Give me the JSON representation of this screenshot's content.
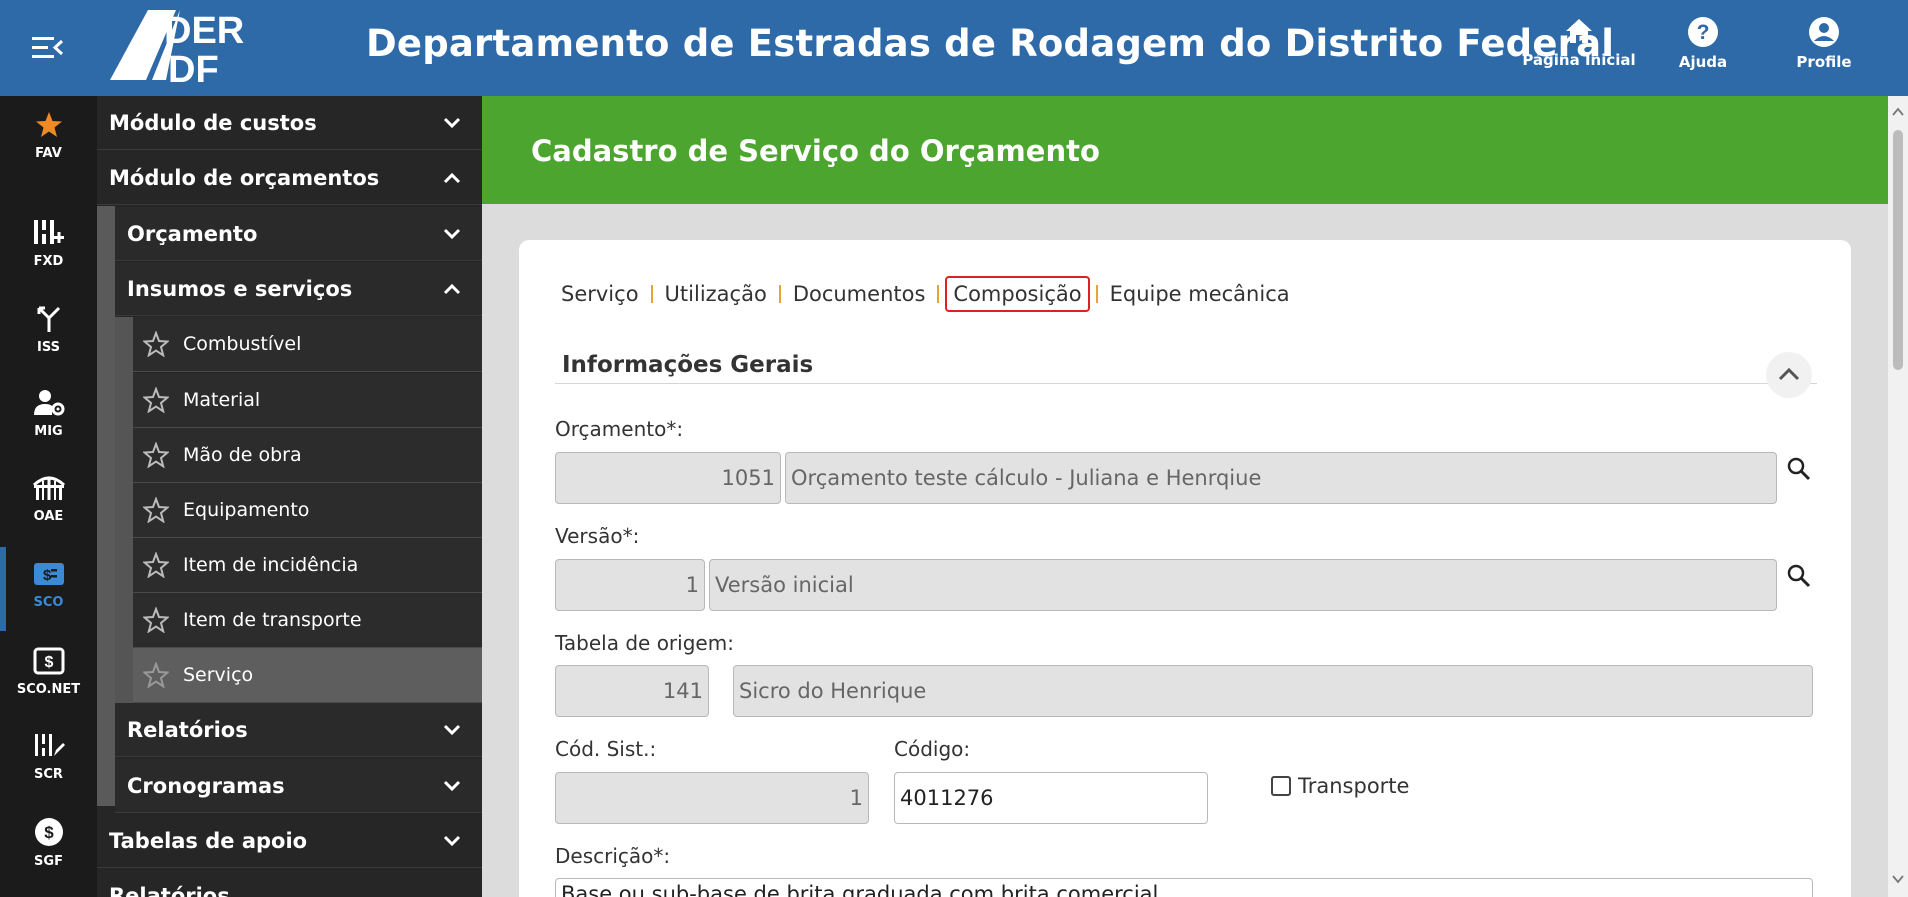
{
  "header": {
    "title": "Departamento de Estradas de Rodagem do Distrito Federal",
    "logo_text": "DER DF",
    "home_label": "Página Inicial",
    "help_label": "Ajuda",
    "profile_label": "Profile"
  },
  "rail": {
    "items": [
      {
        "label": "FAV",
        "icon": "star-icon"
      },
      {
        "label": "FXD",
        "icon": "fxd-icon"
      },
      {
        "label": "ISS",
        "icon": "merge-icon"
      },
      {
        "label": "MIG",
        "icon": "user-gear-icon"
      },
      {
        "label": "OAE",
        "icon": "bridge-icon"
      },
      {
        "label": "SCO",
        "icon": "sco-icon"
      },
      {
        "label": "SCO.NET",
        "icon": "dollar-box-icon"
      },
      {
        "label": "SCR",
        "icon": "scr-icon"
      },
      {
        "label": "SGF",
        "icon": "dollar-circle-icon"
      }
    ]
  },
  "menu": {
    "modulo_custos": "Módulo de custos",
    "modulo_orcamentos": "Módulo de orçamentos",
    "orcamento": "Orçamento",
    "insumos": "Insumos e serviços",
    "sub_items": [
      "Combustível",
      "Material",
      "Mão de obra",
      "Equipamento",
      "Item de incidência",
      "Item de transporte",
      "Serviço"
    ],
    "relatorios": "Relatórios",
    "cronogramas": "Cronogramas",
    "tabelas_apoio": "Tabelas de apoio",
    "relatorios_cut": "Relatórios"
  },
  "main": {
    "banner_title": "Cadastro de Serviço do Orçamento",
    "tabs": [
      "Serviço",
      "Utilização",
      "Documentos",
      "Composição",
      "Equipe mecânica"
    ],
    "section_title": "Informações Gerais",
    "orcamento_label": "Orçamento*:",
    "orcamento_code": "1051",
    "orcamento_name": "Orçamento teste cálculo - Juliana e Henrqiue",
    "versao_label": "Versão*:",
    "versao_code": "1",
    "versao_name": "Versão inicial",
    "tabela_label": "Tabela de origem:",
    "tabela_code": "141",
    "tabela_name": "Sicro do Henrique",
    "cod_sist_label": "Cód. Sist.:",
    "cod_sist_value": "1",
    "codigo_label": "Código:",
    "codigo_value": "4011276",
    "transporte_label": "Transporte",
    "transporte_checked": false,
    "descricao_label": "Descrição*:",
    "descricao_value": "Base ou sub-base de brita graduada com brita comercial"
  },
  "colors": {
    "header_bg": "#2e69a8",
    "banner_bg": "#4ca52f",
    "rail_bg": "#1b1b1b",
    "menu_bg": "#262626",
    "tab_separator": "#e8a33a",
    "highlight_border": "#e02020",
    "fav_star": "#f08a24",
    "active_rail": "#3b8ad4"
  }
}
